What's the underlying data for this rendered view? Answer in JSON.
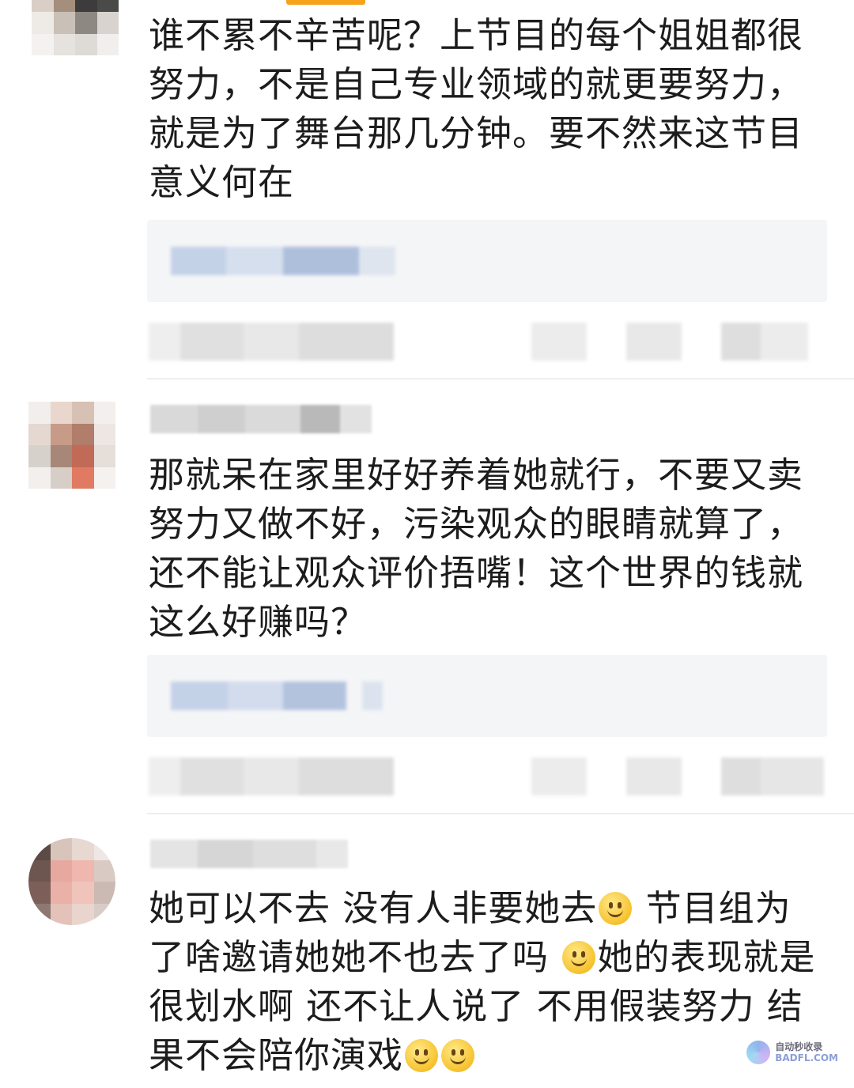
{
  "comments": [
    {
      "text": "谁不累不辛苦呢？上节目的每个姐姐都很努力，不是自己专业领域的就更要努力，就是为了舞台那几分钟。要不然来这节目意义何在"
    },
    {
      "text": "那就呆在家里好好养着她就行，不要又卖努力又做不好，污染观众的眼睛就算了，还不能让观众评价捂嘴！这个世界的钱就这么好赚吗？"
    },
    {
      "segments": [
        "她可以不去 没有人非要她去",
        "节目组为了啥邀请她她不也去了吗",
        "她的表现就是很划水啊 还不让人说了 不用假装努力 结果不会陪你演戏"
      ],
      "emoji": "smile-emoji"
    }
  ],
  "watermark": {
    "line1": "自动秒收录",
    "line2": "BADFL.COM"
  },
  "colors": {
    "accent": "#f7a21b",
    "reply_bg": "#f4f5f7",
    "divider": "#eeeeee"
  }
}
